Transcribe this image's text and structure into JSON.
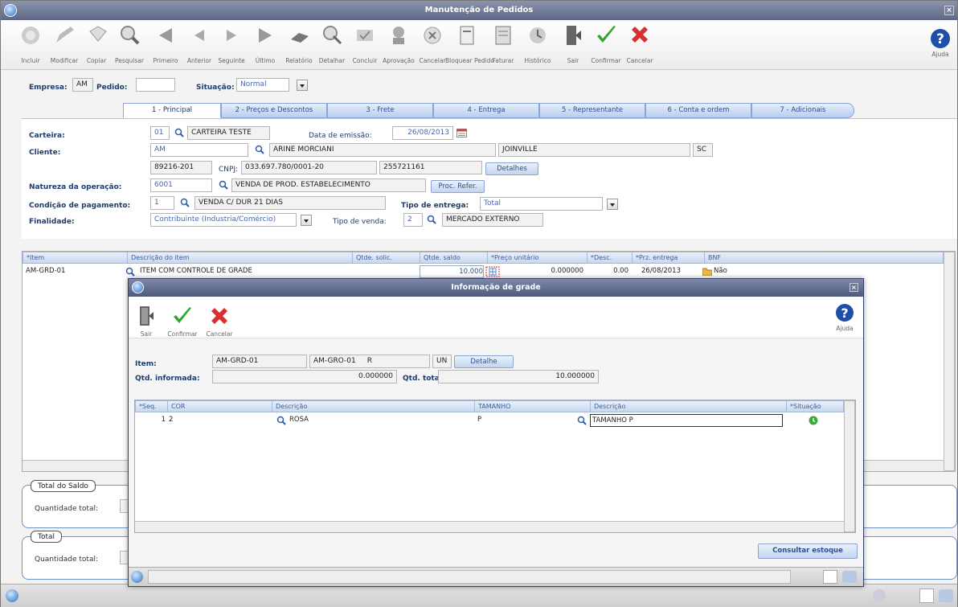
{
  "window": {
    "title": "Manutenção de Pedidos"
  },
  "toolbar": {
    "buttons": [
      {
        "label": "Incluir",
        "icon": "include-icon"
      },
      {
        "label": "Modificar",
        "icon": "edit-icon"
      },
      {
        "label": "Copiar",
        "icon": "copy-icon"
      },
      {
        "label": "Pesquisar",
        "icon": "search-icon"
      },
      {
        "label": "Primeiro",
        "icon": "first-icon"
      },
      {
        "label": "Anterior",
        "icon": "previous-icon"
      },
      {
        "label": "Seguinte",
        "icon": "next-icon"
      },
      {
        "label": "Último",
        "icon": "last-icon"
      },
      {
        "label": "Relatório",
        "icon": "report-icon"
      },
      {
        "label": "Detalhar",
        "icon": "detail-icon"
      },
      {
        "label": "Concluir",
        "icon": "conclude-icon"
      },
      {
        "label": "Aprovação",
        "icon": "approval-icon"
      },
      {
        "label": "Cancelar",
        "icon": "cancel-order-icon"
      },
      {
        "label": "Bloquear Pedido",
        "icon": "block-icon"
      },
      {
        "label": "Faturar",
        "icon": "invoice-icon"
      },
      {
        "label": "Histórico",
        "icon": "history-icon"
      },
      {
        "label": "Sair",
        "icon": "exit-icon"
      },
      {
        "label": "Confirmar",
        "icon": "confirm-icon"
      },
      {
        "label": "Cancelar",
        "icon": "cancel-icon"
      }
    ],
    "help_label": "Ajuda"
  },
  "header": {
    "empresa_label": "Empresa:",
    "empresa_value": "AM",
    "pedido_label": "Pedido:",
    "pedido_value": "",
    "situacao_label": "Situação:",
    "situacao_value": "Normal"
  },
  "tabs": [
    "1 - Principal",
    "2 - Preços e Descontos",
    "3 - Frete",
    "4 - Entrega",
    "5 - Representante",
    "6 - Conta e ordem",
    "7 - Adicionais"
  ],
  "form": {
    "carteira_label": "Carteira:",
    "carteira_code": "01",
    "carteira_name": "CARTEIRA TESTE",
    "data_emissao_label": "Data de emissão:",
    "data_emissao": "26/08/2013",
    "cliente_label": "Cliente:",
    "cliente_code": "AM",
    "cliente_name": "ARINE MORCIANI",
    "cliente_city": "JOINVILLE",
    "cliente_uf": "SC",
    "cep": "89216-201",
    "cnpj_label": "CNPJ:",
    "cnpj": "033.697.780/0001-20",
    "ie": "255721161",
    "detalhes_btn": "Detalhes",
    "natureza_label": "Natureza da operação:",
    "natureza_code": "6001",
    "natureza_name": "VENDA DE PROD. ESTABELECIMENTO",
    "proc_refer_btn": "Proc. Refer.",
    "condicao_label": "Condição de pagamento:",
    "condicao_code": "1",
    "condicao_name": "VENDA C/ DUR 21 DIAS",
    "tipo_entrega_label": "Tipo de entrega:",
    "tipo_entrega": "Total",
    "finalidade_label": "Finalidade:",
    "finalidade": "Contribuinte (Industria/Comércio)",
    "tipo_venda_label": "Tipo de venda:",
    "tipo_venda_code": "2",
    "tipo_venda_name": "MERCADO EXTERNO"
  },
  "items_grid": {
    "headers": [
      "*Item",
      "Descrição do item",
      "Qtde. solic.",
      "Qtde. saldo",
      "*Preço unitário",
      "*Desc.",
      "*Prz. entrega",
      "BNF"
    ],
    "rows": [
      {
        "item": "AM-GRD-01",
        "descricao": "ITEM COM CONTROLE DE GRADE",
        "qtde_solic": "",
        "qtde_saldo": "10.000",
        "preco": "0.000000",
        "desc": "0.00",
        "prazo": "26/08/2013",
        "bnf": "Não"
      }
    ]
  },
  "totals": {
    "saldo_title": "Total do Saldo",
    "saldo_qty_label": "Quantidade total:",
    "total_title": "Total",
    "total_qty_label": "Quantidade total:"
  },
  "dialog": {
    "title": "Informação de grade",
    "toolbar": [
      {
        "label": "Sair",
        "icon": "exit-icon"
      },
      {
        "label": "Confirmar",
        "icon": "confirm-icon"
      },
      {
        "label": "Cancelar",
        "icon": "cancel-icon"
      }
    ],
    "help_label": "Ajuda",
    "item_label": "Item:",
    "item_code": "AM-GRD-01",
    "item_ref": "AM-GRO-01",
    "item_r": "R",
    "item_unit": "UN",
    "detalhe_btn": "Detalhe",
    "qtd_informada_label": "Qtd. informada:",
    "qtd_informada": "0.000000",
    "qtd_total_label": "Qtd. total:",
    "qtd_total": "10.000000",
    "grid_headers": [
      "*Seq.",
      "COR",
      "Descrição",
      "TAMANHO",
      "Descrição",
      "*Situação"
    ],
    "grid_rows": [
      {
        "seq": "1",
        "cor": "2",
        "cor_desc": "ROSA",
        "tamanho": "P",
        "tamanho_desc": "TAMANHO P"
      }
    ],
    "consultar_btn": "Consultar estoque"
  }
}
